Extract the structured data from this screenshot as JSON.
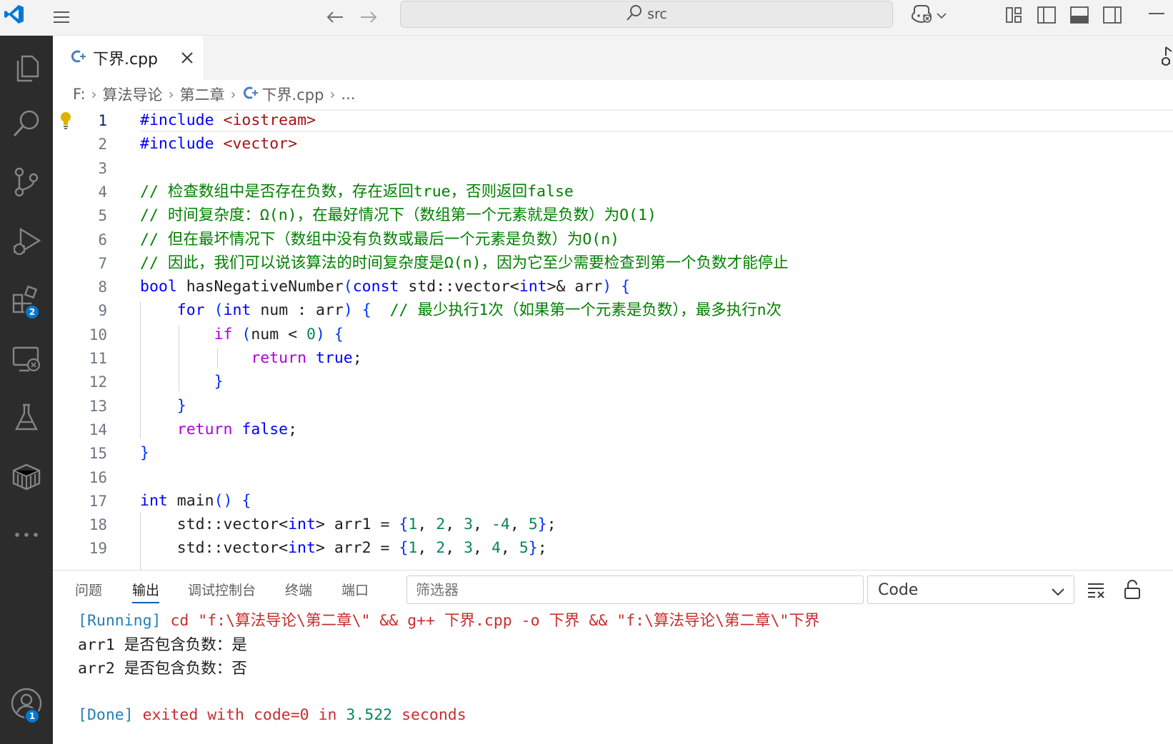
{
  "titlebar": {
    "search_text": "src",
    "icons": [
      "vscode-logo-icon",
      "menu-icon",
      "back-arrow-icon",
      "forward-arrow-icon",
      "search-icon",
      "copilot-icon",
      "chevron-down-icon",
      "customize-layout-icon",
      "toggle-primary-sidebar-icon",
      "toggle-panel-icon",
      "toggle-secondary-sidebar-icon",
      "minimize-icon"
    ]
  },
  "activitybar": {
    "items": [
      {
        "name": "explorer-icon"
      },
      {
        "name": "search-icon"
      },
      {
        "name": "source-control-icon"
      },
      {
        "name": "run-debug-icon"
      },
      {
        "name": "extensions-icon",
        "badge": "2"
      },
      {
        "name": "remote-explorer-icon"
      },
      {
        "name": "testing-icon"
      },
      {
        "name": "containers-icon"
      },
      {
        "name": "more-icon"
      }
    ],
    "accounts_badge": "1"
  },
  "tab": {
    "label": "下界.cpp",
    "icon": "cpp-file-icon"
  },
  "breadcrumb": {
    "items": [
      "F:",
      "算法导论",
      "第二章",
      "下界.cpp",
      "..."
    ]
  },
  "editor": {
    "language": "cpp",
    "active_line": 1,
    "colors": {
      "keyword": "#0000ff",
      "comment": "#008000",
      "string": "#a31515",
      "number": "#098658",
      "control": "#af00db"
    },
    "lines": [
      "#include <iostream>",
      "#include <vector>",
      "",
      "// 检查数组中是否存在负数，存在返回true，否则返回false",
      "// 时间复杂度：Ω(n)，在最好情况下（数组第一个元素就是负数）为O(1)",
      "// 但在最坏情况下（数组中没有负数或最后一个元素是负数）为O(n)",
      "// 因此，我们可以说该算法的时间复杂度是Ω(n)，因为它至少需要检查到第一个负数才能停止",
      "bool hasNegativeNumber(const std::vector<int>& arr) {",
      "    for (int num : arr) {  // 最少执行1次（如果第一个元素是负数），最多执行n次",
      "        if (num < 0) {",
      "            return true;",
      "        }",
      "    }",
      "    return false;",
      "}",
      "",
      "int main() {",
      "    std::vector<int> arr1 = {1, 2, 3, -4, 5};",
      "    std::vector<int> arr2 = {1, 2, 3, 4, 5};"
    ]
  },
  "panel": {
    "tabs": [
      "问题",
      "输出",
      "调试控制台",
      "终端",
      "端口"
    ],
    "active_tab": "输出",
    "filter_placeholder": "筛选器",
    "channel": "Code",
    "output": {
      "run_tag": "[Running]",
      "run_cmd": " cd \"f:\\算法导论\\第二章\\\" && g++ 下界.cpp -o 下界 && \"f:\\算法导论\\第二章\\\"下界",
      "line1": "arr1 是否包含负数：是",
      "line2": "arr2 是否包含负数：否",
      "done_tag": "[Done]",
      "done_msg_a": " exited with ",
      "done_code": "code=0",
      "done_msg_b": " in ",
      "done_time": "3.522",
      "done_msg_c": " seconds"
    }
  }
}
